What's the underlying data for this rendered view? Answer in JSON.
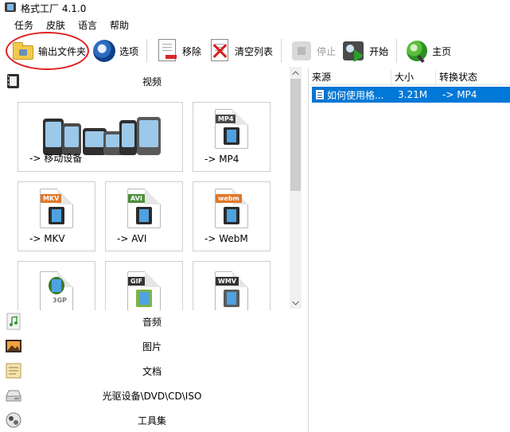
{
  "window": {
    "title": "格式工厂 4.1.0"
  },
  "menu": {
    "items": [
      "任务",
      "皮肤",
      "语言",
      "帮助"
    ]
  },
  "toolbar": {
    "output_folder": "输出文件夹",
    "options": "选项",
    "remove": "移除",
    "clear_list": "清空列表",
    "stop": "停止",
    "start": "开始",
    "home": "主页"
  },
  "categories": {
    "video": "视频",
    "audio": "音频",
    "picture": "图片",
    "document": "文档",
    "optical": "光驱设备\\DVD\\CD\\ISO",
    "tools": "工具集"
  },
  "video_tiles": [
    {
      "label": "-> 移动设备"
    },
    {
      "label": "-> MP4",
      "badge": "MP4",
      "badge_color": "#4a4a4a"
    },
    {
      "label": "-> MKV",
      "badge": "MKV",
      "badge_color": "#e0772a"
    },
    {
      "label": "-> AVI",
      "badge": "AVI",
      "badge_color": "#4d8f3a"
    },
    {
      "label": "-> WebM",
      "badge": "webm",
      "badge_color": "#e0772a"
    },
    {
      "label": "",
      "badge": "3GP",
      "badge_color": "#4d8f3a"
    },
    {
      "label": "",
      "badge": "GIF",
      "badge_color": "#333333"
    },
    {
      "label": "",
      "badge": "WMV",
      "badge_color": "#333333"
    }
  ],
  "task_table": {
    "headers": [
      "来源",
      "大小",
      "转换状态"
    ],
    "rows": [
      {
        "source": "如何使用格...",
        "size": "3.21M",
        "status": "-> MP4",
        "selected": true
      }
    ]
  },
  "colors": {
    "selection": "#0078d7",
    "highlight_ellipse": "#e02020",
    "start_arrow": "#2ba02b"
  }
}
